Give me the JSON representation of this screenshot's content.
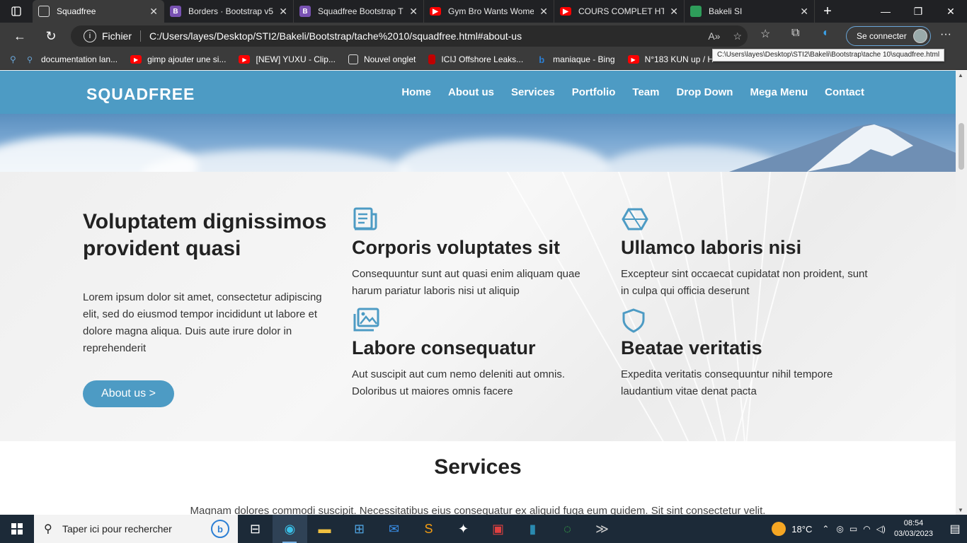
{
  "browser": {
    "tabs": [
      {
        "title": "Squadfree",
        "active": true,
        "favicon": "page-icon",
        "color": "#3b3b3b"
      },
      {
        "title": "Borders · Bootstrap v5",
        "active": false,
        "favicon": "bootstrap-icon",
        "color": "#7952b3"
      },
      {
        "title": "Squadfree Bootstrap T",
        "active": false,
        "favicon": "bootstrap-icon",
        "color": "#7952b3"
      },
      {
        "title": "Gym Bro Wants Wome",
        "active": false,
        "favicon": "youtube-icon",
        "color": "#ff0000"
      },
      {
        "title": "COURS COMPLET HTM",
        "active": false,
        "favicon": "youtube-icon",
        "color": "#ff0000"
      },
      {
        "title": "Bakeli SI",
        "active": false,
        "favicon": "bakeli-icon",
        "color": "#2e9d5a"
      }
    ],
    "address": {
      "scheme_label": "Fichier",
      "url": "C:/Users/layes/Desktop/STI2/Bakeli/Bootstrap/tache%2010/squadfree.html#about-us"
    },
    "signin_label": "Se connecter",
    "bookmarks": [
      {
        "label": "documentation lan...",
        "icon": "search-icon",
        "color": "#3a7bd5"
      },
      {
        "label": "gimp ajouter une si...",
        "icon": "youtube-icon",
        "color": "#ff0000"
      },
      {
        "label": "[NEW] YUXU - Clip...",
        "icon": "youtube-icon",
        "color": "#ff0000"
      },
      {
        "label": "Nouvel onglet",
        "icon": "newtab-icon",
        "color": "#555555"
      },
      {
        "label": "ICIJ Offshore Leaks...",
        "icon": "icij-icon",
        "color": "#c00000"
      },
      {
        "label": "maniaque - Bing",
        "icon": "bing-icon",
        "color": "#2c7fd4"
      },
      {
        "label": "N°183 KUN up / H",
        "icon": "youtube-icon",
        "color": "#ff0000"
      }
    ],
    "tooltip": "C:\\Users\\layes\\Desktop\\STI2\\Bakeli\\Bootstrap\\tache 10\\squadfree.html"
  },
  "site": {
    "logo": "SQUADFREE",
    "nav": [
      "Home",
      "About us",
      "Services",
      "Portfolio",
      "Team",
      "Drop Down",
      "Mega Menu",
      "Contact"
    ],
    "about": {
      "title": "Voluptatem dignissimos provident quasi",
      "text": "Lorem ipsum dolor sit amet, consectetur adipiscing elit, sed do eiusmod tempor incididunt ut labore et dolore magna aliqua. Duis aute irure dolor in reprehenderit",
      "button": "About us >"
    },
    "features": [
      {
        "icon": "document-icon",
        "title": "Corporis voluptates sit",
        "text": "Consequuntur sunt aut quasi enim aliquam quae harum pariatur laboris nisi ut aliquip"
      },
      {
        "icon": "cube-icon",
        "title": "Ullamco laboris nisi",
        "text": "Excepteur sint occaecat cupidatat non proident, sunt in culpa qui officia deserunt"
      },
      {
        "icon": "images-icon",
        "title": "Labore consequatur",
        "text": "Aut suscipit aut cum nemo deleniti aut omnis. Doloribus ut maiores omnis facere"
      },
      {
        "icon": "shield-icon",
        "title": "Beatae veritatis",
        "text": "Expedita veritatis consequuntur nihil tempore laudantium vitae denat pacta"
      }
    ],
    "services": {
      "title": "Services",
      "text": "Magnam dolores commodi suscipit. Necessitatibus eius consequatur ex aliquid fuga eum quidem. Sit sint consectetur velit."
    },
    "accent_color": "#4d9bc4"
  },
  "taskbar": {
    "search_placeholder": "Taper ici pour rechercher",
    "weather": "18°C",
    "time": "08:54",
    "date": "03/03/2023"
  }
}
